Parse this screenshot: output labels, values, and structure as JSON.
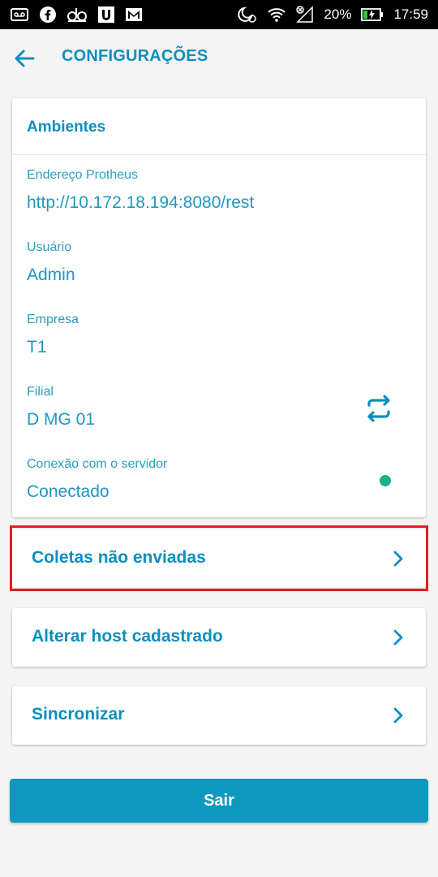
{
  "status_bar": {
    "battery_percent": "20%",
    "time": "17:59",
    "icons_left": [
      "voicemail-icon",
      "facebook-icon",
      "ubook-icon",
      "u-app-icon",
      "gmail-icon"
    ],
    "icons_right": [
      "do-not-disturb-alarm-icon",
      "wifi-icon",
      "no-signal-icon",
      "battery-charging-icon"
    ]
  },
  "header": {
    "title": "CONFIGURAÇÕES",
    "back_icon": "arrow-left-icon"
  },
  "environments": {
    "title": "Ambientes",
    "fields": [
      {
        "label": "Endereço Protheus",
        "value": "http://10.172.18.194:8080/rest"
      },
      {
        "label": "Usuário",
        "value": "Admin"
      },
      {
        "label": "Empresa",
        "value": "T1"
      },
      {
        "label": "Filial",
        "value": "D MG 01"
      },
      {
        "label": "Conexão com o servidor",
        "value": "Conectado"
      }
    ],
    "branch_action_icon": "swap-icon",
    "connection_status_color": "#17b38a"
  },
  "menu": {
    "items": [
      {
        "label": "Coletas não enviadas",
        "icon": "chevron-right-icon"
      },
      {
        "label": "Alterar host cadastrado",
        "icon": "chevron-right-icon"
      },
      {
        "label": "Sincronizar",
        "icon": "chevron-right-icon"
      }
    ]
  },
  "logout": {
    "label": "Sair"
  },
  "colors": {
    "accent": "#0b8fbf",
    "button": "#0c98c0",
    "highlight": "#e02020",
    "background": "#f4f4f4"
  }
}
